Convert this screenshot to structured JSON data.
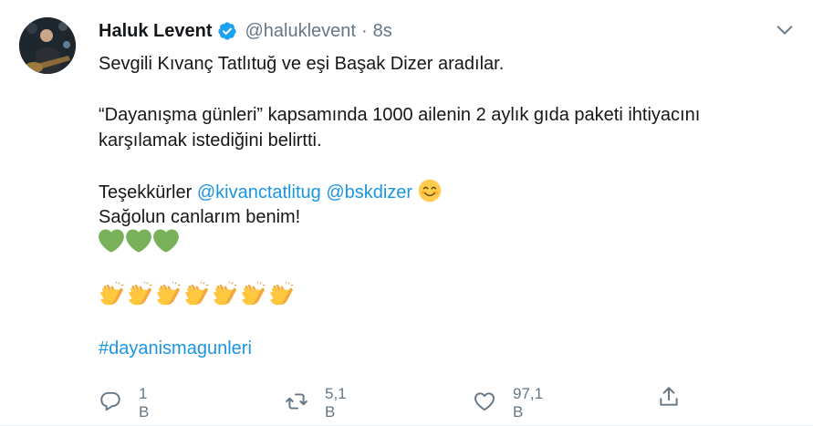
{
  "tweet": {
    "author_name": "Haluk Levent",
    "handle": "@haluklevent",
    "separator": "·",
    "time": "8s",
    "lines": {
      "l1": "Sevgili Kıvanç Tatlıtuğ ve eşi Başak Dizer aradılar.",
      "l2": "“Dayanışma günleri” kapsamında 1000 ailenin 2 aylık gıda paketi ihtiyacını",
      "l3": "karşılamak istediğini belirtti.",
      "l4_prefix": "Teşekkürler",
      "mention1": "@kivanctatlitug",
      "mention2": "@bskdizer",
      "l5": "Sağolun canlarım benim!",
      "hashtag": "#dayanismagunleri"
    },
    "emoji": {
      "smile": "smiling-face-icon",
      "hearts": [
        "green-heart-icon",
        "green-heart-icon",
        "green-heart-icon"
      ],
      "claps": [
        "clapping-hands-icon",
        "clapping-hands-icon",
        "clapping-hands-icon",
        "clapping-hands-icon",
        "clapping-hands-icon",
        "clapping-hands-icon",
        "clapping-hands-icon"
      ]
    },
    "actions": {
      "replies": "1 B",
      "retweets": "5,1 B",
      "likes": "97,1 B"
    }
  },
  "colors": {
    "link": "#1b95e0",
    "secondary": "#657786",
    "verified": "#1da1f2",
    "heart_green": "#78b159",
    "clap_yellow": "#ffc83d"
  }
}
